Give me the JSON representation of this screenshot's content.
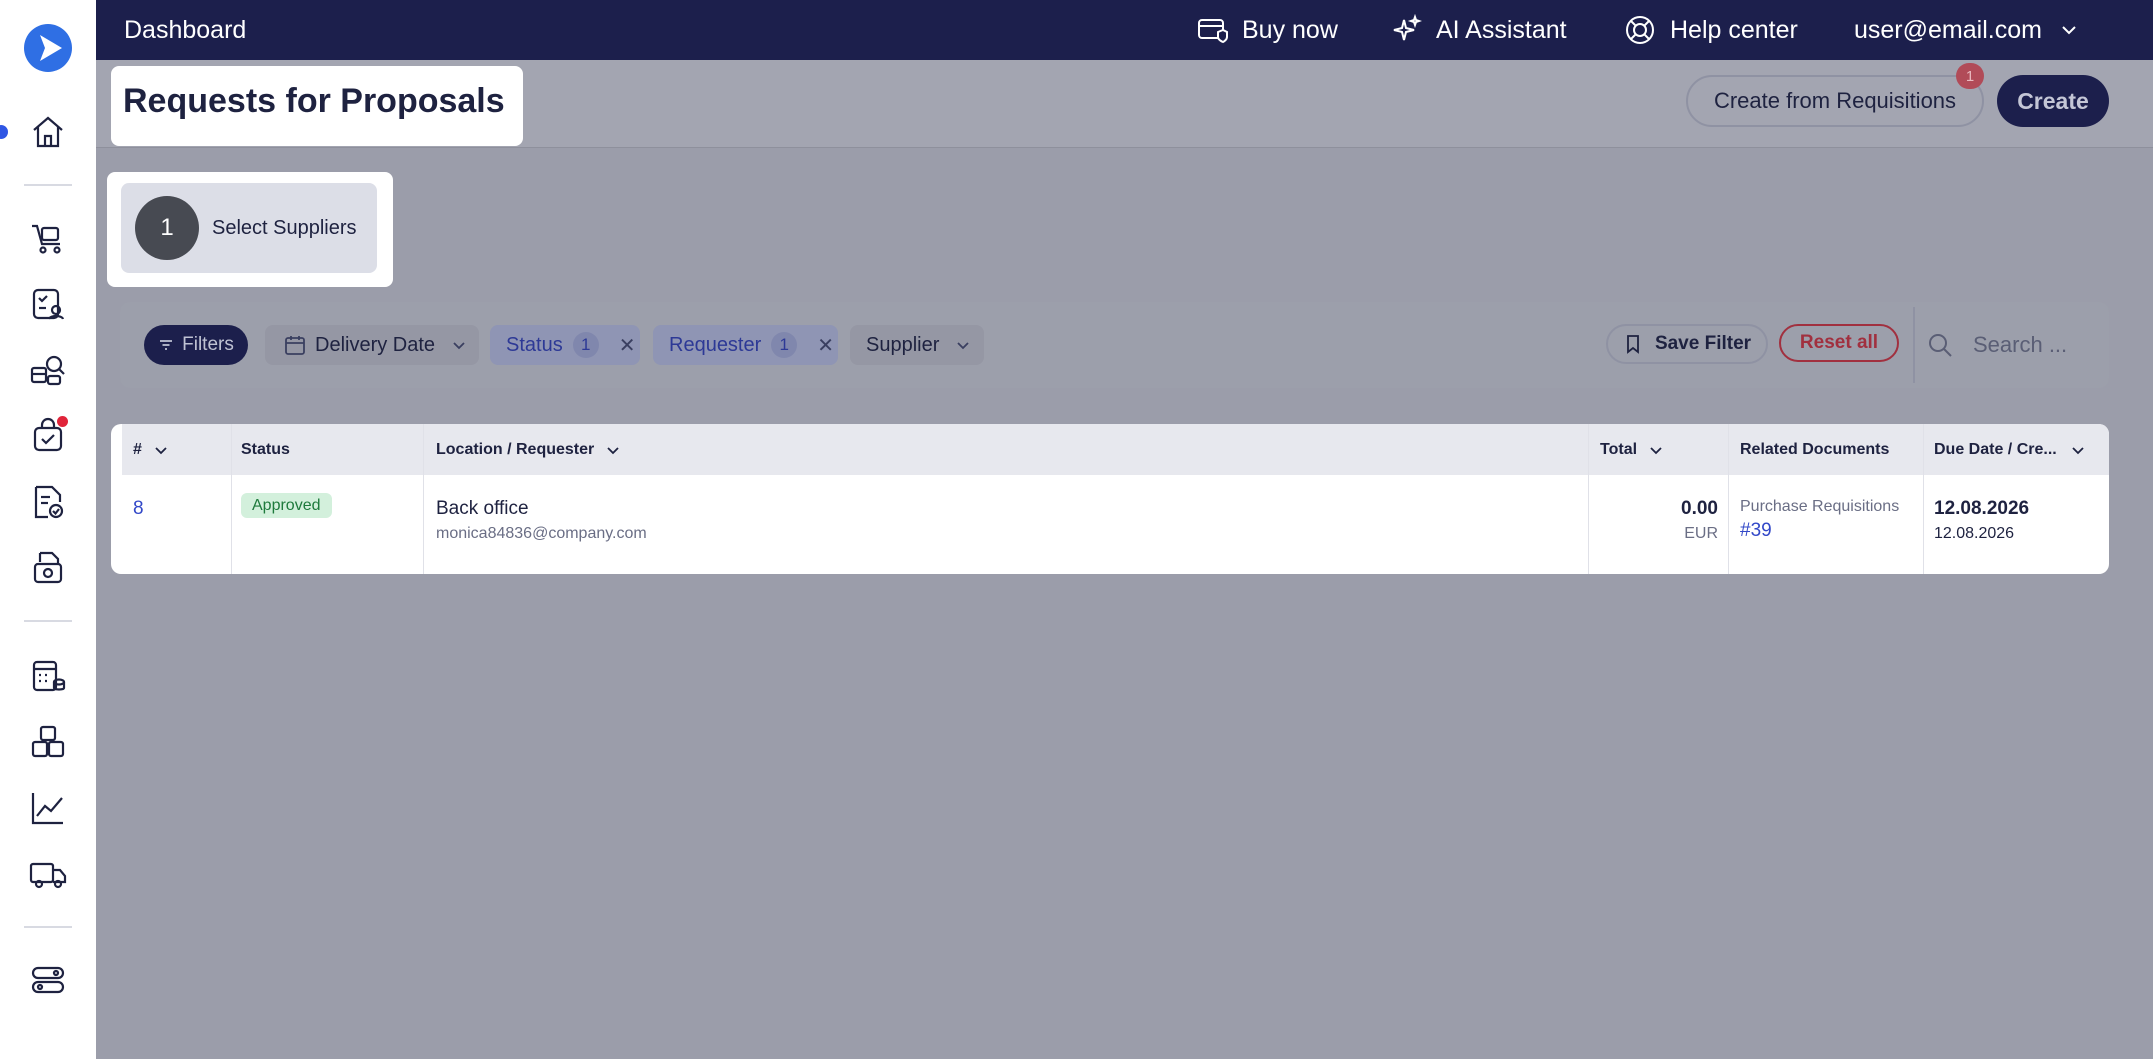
{
  "topbar": {
    "title": "Dashboard",
    "buy_now": "Buy now",
    "ai_assistant": "AI Assistant",
    "help_center": "Help center",
    "user": "user@email.com"
  },
  "page": {
    "title": "Requests for Proposals",
    "create_from_requisitions": "Create from Requisitions",
    "notification_count": "1",
    "create": "Create"
  },
  "stepper": {
    "step_number": "1",
    "step_label": "Select Suppliers"
  },
  "filters": {
    "filters_label": "Filters",
    "delivery_date": "Delivery Date",
    "status": "Status",
    "status_count": "1",
    "requester": "Requester",
    "requester_count": "1",
    "supplier": "Supplier",
    "save_filter": "Save Filter",
    "reset_all": "Reset all",
    "search_placeholder": "Search ..."
  },
  "table": {
    "columns": {
      "number": "#",
      "status": "Status",
      "location": "Location / Requester",
      "total": "Total",
      "related": "Related Documents",
      "due": "Due Date / Cre..."
    },
    "rows": [
      {
        "number": "8",
        "status": "Approved",
        "location": "Back office",
        "requester": "monica84836@company.com",
        "total": "0.00",
        "currency": "EUR",
        "related_type": "Purchase Requisitions",
        "related_link": "#39",
        "due_date": "12.08.2026",
        "created_date": "12.08.2026"
      }
    ]
  },
  "colors": {
    "brand_dark": "#1c1f4c",
    "accent_blue": "#2f6fe4",
    "approved_bg": "#d3f0dc",
    "reset_red": "#a1303f"
  }
}
